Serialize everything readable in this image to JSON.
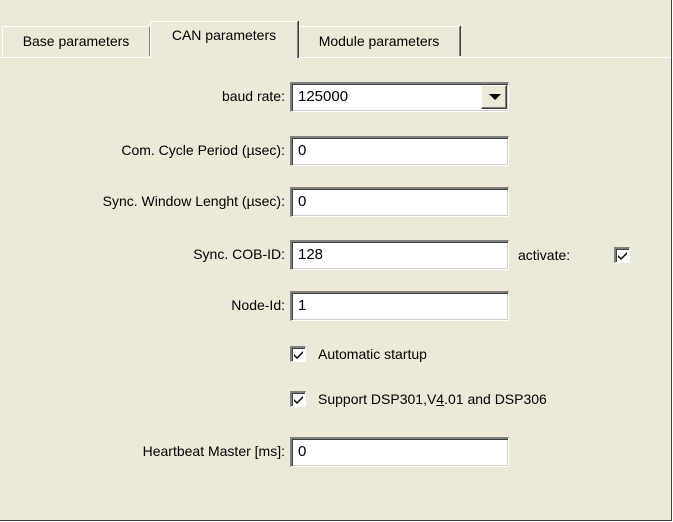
{
  "tabs": {
    "base": "Base parameters",
    "can": "CAN parameters",
    "module": "Module parameters"
  },
  "form": {
    "baud_rate": {
      "label": "baud rate:",
      "value": "125000"
    },
    "com_cycle": {
      "label": "Com. Cycle Period (µsec):",
      "value": "0"
    },
    "sync_window": {
      "label": "Sync. Window Lenght (µsec):",
      "value": "0"
    },
    "sync_cob": {
      "label": "Sync. COB-ID:",
      "value": "128"
    },
    "activate": {
      "label": "activate:",
      "checked": true
    },
    "node_id": {
      "label": "Node-Id:",
      "value": "1"
    },
    "automatic_startup": {
      "label": "Automatic startup",
      "checked": true
    },
    "support_dsp": {
      "label_pre": "Support DSP301,V",
      "label_ul": "4",
      "label_post": ".01 and DSP306",
      "checked": true
    },
    "heartbeat": {
      "label": "Heartbeat Master [ms]:",
      "value": "0"
    }
  },
  "icons": {
    "dropdown": "chevron-down-icon",
    "check": "checkmark-icon"
  },
  "colors": {
    "face": "#ece9d8",
    "field_bg": "#ffffff",
    "shadow": "#808080"
  }
}
